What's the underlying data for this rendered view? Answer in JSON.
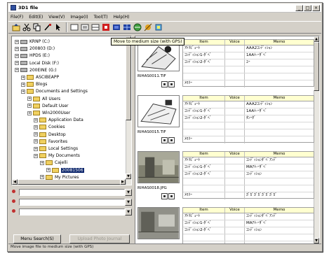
{
  "window": {
    "title": "3D1 file"
  },
  "menu": [
    "File(F)",
    "Edit(E)",
    "View(V)",
    "Image(I)",
    "Tool(T)",
    "Help(H)"
  ],
  "toolbar": {
    "icons": [
      "up-folder-icon",
      "cut-icon",
      "copy-icon",
      "paint-icon",
      "pointer-icon",
      "frame-icon",
      "frame-2-icon",
      "frame-3-icon",
      "record-icon",
      "map-icon",
      "map-2-icon",
      "globe-icon",
      "satellite-icon",
      "settings-icon"
    ],
    "tooltip": "Move to medium size (with GPS)"
  },
  "tree": {
    "items": [
      {
        "label": "KRNP (C:)",
        "kind": "drive",
        "indent": 0
      },
      {
        "label": "200803 (D:)",
        "kind": "drive",
        "indent": 0
      },
      {
        "label": "HPDS (E:)",
        "kind": "drive",
        "indent": 0
      },
      {
        "label": "Local Disk (F:)",
        "kind": "drive",
        "indent": 0
      },
      {
        "label": "200EINE (G:)",
        "kind": "drive",
        "indent": 0
      },
      {
        "label": "ASCIBEAPP",
        "kind": "folder",
        "indent": 1
      },
      {
        "label": "Blogs",
        "kind": "folder",
        "indent": 1
      },
      {
        "label": "Documents and Settings",
        "kind": "folder",
        "indent": 1
      },
      {
        "label": "All Users",
        "kind": "folder",
        "indent": 2
      },
      {
        "label": "Default User",
        "kind": "folder",
        "indent": 2
      },
      {
        "label": "Win2000User",
        "kind": "folder",
        "indent": 2
      },
      {
        "label": "Application Data",
        "kind": "folder",
        "indent": 3
      },
      {
        "label": "Cookies",
        "kind": "folder",
        "indent": 3
      },
      {
        "label": "Desktop",
        "kind": "folder",
        "indent": 3
      },
      {
        "label": "Favorites",
        "kind": "folder",
        "indent": 3
      },
      {
        "label": "Local Settings",
        "kind": "folder",
        "indent": 3
      },
      {
        "label": "My Documents",
        "kind": "folder",
        "indent": 3
      },
      {
        "label": "Cajelli",
        "kind": "folder",
        "indent": 4
      },
      {
        "label": "20081506",
        "kind": "folder",
        "indent": 5,
        "selected": true
      },
      {
        "label": "My Pictures",
        "kind": "folder",
        "indent": 4
      }
    ]
  },
  "filters": [
    "",
    "",
    ""
  ],
  "buttons": {
    "search": "Menu Search(S)",
    "secondary": "Upload Photo Journal"
  },
  "status": "Move image file to medium size (with GPS)",
  "grid_headers": {
    "item": "Item",
    "voice": "Voice",
    "memo": "Memo"
  },
  "entries": [
    {
      "filename": "RIHAS0011.TIF",
      "rows": [
        {
          "item": "ｱﾄﾘﾋﾞｭｰﾄ",
          "voice": "",
          "memo": "AAA2ｺﾝﾃﾞｨｼｮﾝ"
        },
        {
          "item": "ｺﾝﾃﾞｨｼｮﾝ1-ﾀﾞﾍﾞ",
          "voice": "",
          "memo": "1AAﾄ-ｰﾀﾞﾍﾞ"
        },
        {
          "item": "ｺﾝﾃﾞｨｼｮﾝ2-ﾀﾞﾍﾞ",
          "voice": "",
          "memo": "ﾕｰ"
        },
        {
          "item": "",
          "voice": "",
          "memo": ""
        },
        {
          "item": "",
          "voice": "",
          "memo": ""
        },
        {
          "item": "ﾒﾓﾘｰ",
          "voice": "",
          "memo": ""
        }
      ]
    },
    {
      "filename": "RIHAS0015.TIF",
      "rows": [
        {
          "item": "ｱﾄﾘﾋﾞｭｰﾄ",
          "voice": "",
          "memo": "AAA2ｺﾝﾃﾞｨｼｮﾝ"
        },
        {
          "item": "ｺﾝﾃﾞｨｼｮﾝ1-ﾀﾞﾍﾞ",
          "voice": "",
          "memo": "1AAﾄ-ｰﾀﾞﾍﾞ"
        },
        {
          "item": "ｺﾝﾃﾞｨｼｮﾝ2-ﾀﾞﾍﾞ",
          "voice": "",
          "memo": "ﾀﾝｰﾀﾞ"
        },
        {
          "item": "",
          "voice": "",
          "memo": ""
        },
        {
          "item": "",
          "voice": "",
          "memo": ""
        },
        {
          "item": "ﾒﾓﾘｰ",
          "voice": "",
          "memo": ""
        }
      ]
    },
    {
      "filename": "RIHAS0018.JPG",
      "rows": [
        {
          "item": "ｱﾄﾘﾋﾞｭｰﾄ",
          "voice": "",
          "memo": "ｺﾝﾃﾞｨｼｮﾝﾀﾞﾍﾞｱﾝﾃﾞ"
        },
        {
          "item": "ｺﾝﾃﾞｨｼｮﾝ1-ﾀﾞﾍﾞ",
          "voice": "",
          "memo": "MAｱﾄ-ｰﾀﾞﾍﾞ"
        },
        {
          "item": "ｺﾝﾃﾞｨｼｮﾝ2-ﾀﾞﾍﾞ",
          "voice": "",
          "memo": "ｺﾝﾃﾞｨｼｮﾝ"
        },
        {
          "item": "",
          "voice": "",
          "memo": ""
        },
        {
          "item": "",
          "voice": "",
          "memo": ""
        },
        {
          "item": "ﾒﾓﾘｰ",
          "voice": "",
          "memo": "ｶﾞｶﾞｶﾞｶﾞｶﾞｶﾞｶﾞｶﾞ"
        }
      ]
    },
    {
      "filename": "",
      "rows": [
        {
          "item": "ｱﾄﾘﾋﾞｭｰﾄ",
          "voice": "",
          "memo": "ｺﾝﾃﾞｨｼｮﾝﾀﾞﾍﾞｱﾝﾃﾞ"
        },
        {
          "item": "ｺﾝﾃﾞｨｼｮﾝ1-ﾀﾞﾍﾞ",
          "voice": "",
          "memo": "MAｱﾄ-ｰﾀﾞﾍﾞ"
        },
        {
          "item": "ｺﾝﾃﾞｨｼｮﾝ2-ﾀﾞﾍﾞ",
          "voice": "",
          "memo": "ｺﾝﾃﾞｨｼｮﾝ"
        },
        {
          "item": "",
          "voice": "",
          "memo": ""
        },
        {
          "item": "",
          "voice": "",
          "memo": ""
        },
        {
          "item": "",
          "voice": "",
          "memo": ""
        }
      ]
    }
  ]
}
